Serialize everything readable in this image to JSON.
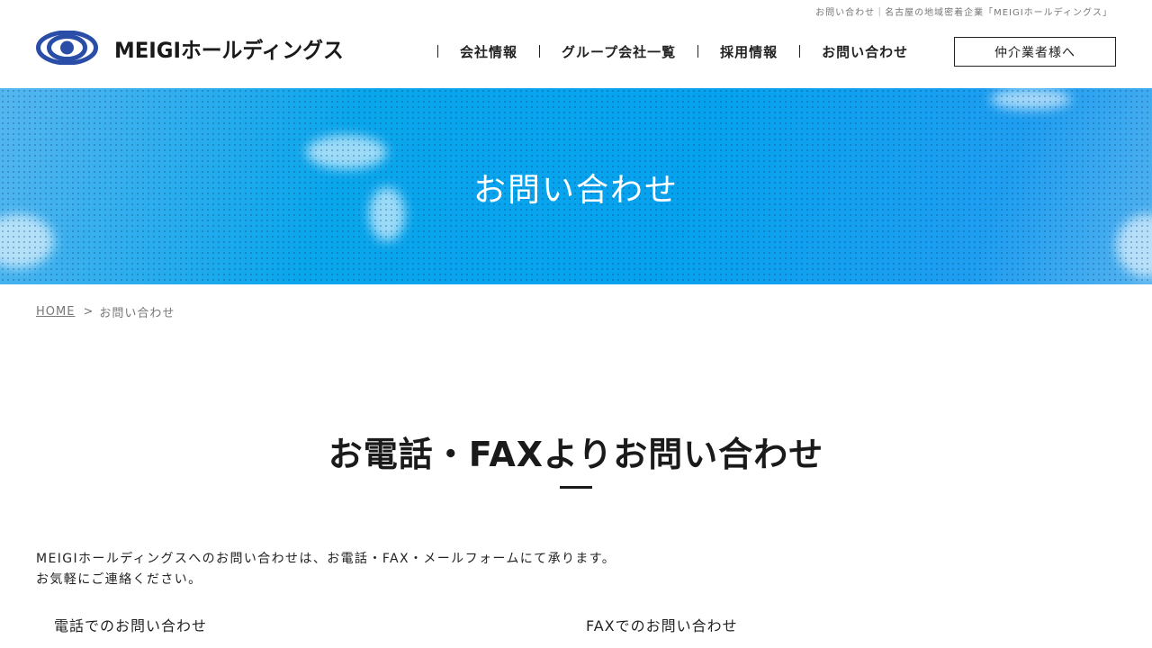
{
  "header": {
    "tagline": "お問い合わせ｜名古屋の地域密着企業「MEIGIホールディングス」",
    "logo_text": "MEIGIホールディングス",
    "logo_icon": "meigi-ring-logo",
    "nav": [
      {
        "label": "会社情報"
      },
      {
        "label": "グループ会社一覧"
      },
      {
        "label": "採用情報"
      },
      {
        "label": "お問い合わせ"
      }
    ],
    "agent_button": "仲介業者様へ"
  },
  "hero": {
    "title": "お問い合わせ"
  },
  "breadcrumb": {
    "home": "HOME",
    "separator": ">",
    "current": "お問い合わせ"
  },
  "main": {
    "section_title": "お電話・FAXよりお問い合わせ",
    "intro_line1": "MEIGIホールディングスへのお問い合わせは、お電話・FAX・メールフォームにて承ります。",
    "intro_line2": "お気軽にご連絡ください。",
    "phone_heading": "電話でのお問い合わせ",
    "fax_heading": "FAXでのお問い合わせ"
  },
  "colors": {
    "brand_blue": "#2a4ea8",
    "hero_blue": "#0aa6ec",
    "text": "#222222"
  }
}
